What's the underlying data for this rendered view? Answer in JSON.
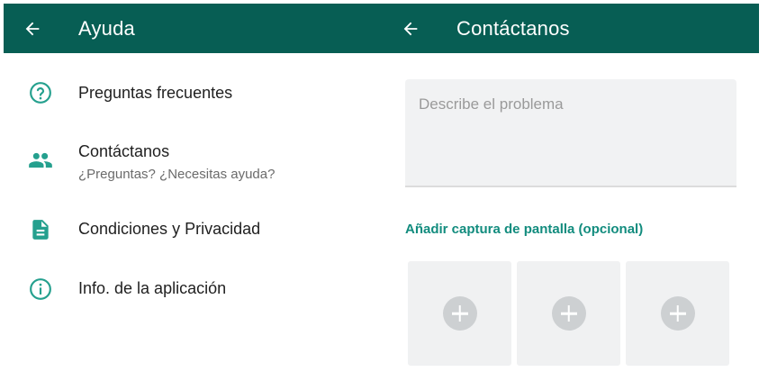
{
  "left_panel": {
    "title": "Ayuda",
    "items": [
      {
        "icon": "help-circle-icon",
        "title": "Preguntas frecuentes"
      },
      {
        "icon": "people-icon",
        "title": "Contáctanos",
        "subtitle": "¿Preguntas? ¿Necesitas ayuda?"
      },
      {
        "icon": "document-icon",
        "title": "Condiciones y Privacidad"
      },
      {
        "icon": "info-circle-icon",
        "title": "Info. de la aplicación"
      }
    ]
  },
  "right_panel": {
    "title": "Contáctanos",
    "problem_placeholder": "Describe el problema",
    "screenshot_label": "Añadir captura de pantalla (opcional)",
    "screenshot_slots": 3
  },
  "colors": {
    "toolbar": "#075e54",
    "accent": "#128c7e",
    "icon": "#25a08e",
    "slot_bg": "#f0f1f2",
    "plus_bg": "#cdd0d2"
  }
}
